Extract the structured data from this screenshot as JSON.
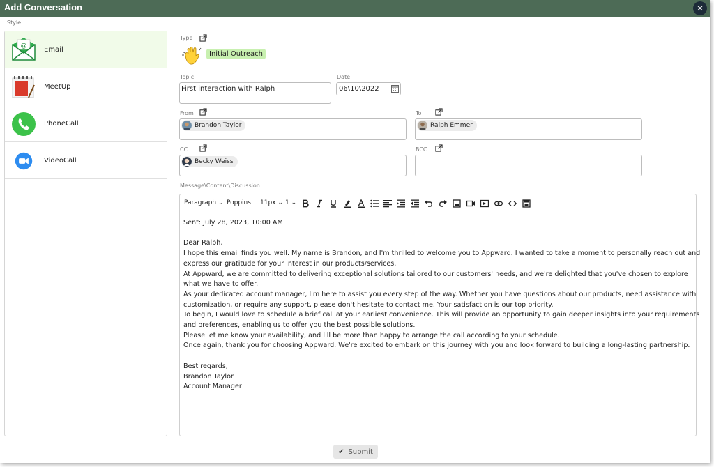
{
  "dialog": {
    "title": "Add Conversation",
    "close_glyph": "✕"
  },
  "style_label": "Style",
  "styles": [
    {
      "label": "Email",
      "icon": "email-icon",
      "active": true
    },
    {
      "label": "MeetUp",
      "icon": "notebook-icon"
    },
    {
      "label": "PhoneCall",
      "icon": "phone-icon"
    },
    {
      "label": "VideoCall",
      "icon": "video-camera-icon"
    }
  ],
  "type": {
    "label": "Type",
    "value": "Initial Outreach",
    "icon": "waving-hand-icon"
  },
  "topic": {
    "label": "Topic",
    "value": "First interaction with Ralph"
  },
  "date": {
    "label": "Date",
    "value": "06\\10\\2022"
  },
  "from": {
    "label": "From",
    "chip": "Brandon Taylor"
  },
  "to": {
    "label": "To",
    "chip": "Ralph Emmer"
  },
  "cc": {
    "label": "CC",
    "chip": "Becky Weiss"
  },
  "bcc": {
    "label": "BCC"
  },
  "message": {
    "label": "Message\\Content\\Discussion",
    "toolbar": {
      "paragraph": "Paragraph",
      "font": "Poppins",
      "size": "11px",
      "line_height": "1",
      "caret": "⌄"
    },
    "lines": [
      "Sent: July 28, 2023, 10:00 AM",
      "",
      "Dear Ralph,",
      "I hope this email finds you well. My name is Brandon, and I'm thrilled to welcome you to Appward. I wanted to take a moment to personally reach out and",
      "express our gratitude for your interest in our products/services.",
      "At Appward, we are committed to delivering exceptional solutions tailored to our customers' needs, and we're delighted that you've chosen to explore",
      "what we have to offer.",
      "As your dedicated account manager, I'm here to assist you every step of the way. Whether you have questions about our products, need assistance with",
      "customization, or require any support, please don't hesitate to contact me. Your satisfaction is our top priority.",
      "To begin, I would love to schedule a brief call at your earliest convenience. This will provide an opportunity to gain deeper insights into your requirements",
      "and preferences, enabling us to offer you the best possible solutions.",
      "Please let me know your availability, and I'll be more than happy to arrange the call according to your schedule.",
      "Once again, thank you for choosing Appward. We're excited to embark on this journey with you and look forward to building a long-lasting partnership.",
      "",
      "Best regards,",
      "Brandon Taylor",
      "Account Manager"
    ]
  },
  "submit": {
    "label": "Submit",
    "glyph": "✔"
  },
  "colors": {
    "titlebar": "#4d6b56",
    "tag": "#c8f0b0",
    "active_style": "#f1fbe9",
    "phone": "#3cc24a",
    "video": "#2d8cf0"
  }
}
